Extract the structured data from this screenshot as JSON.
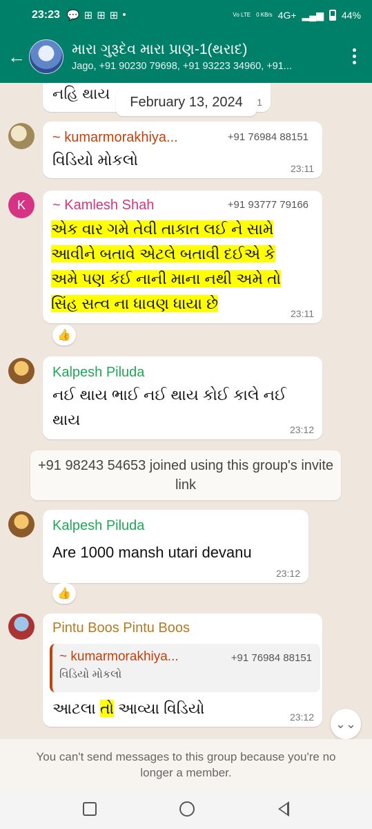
{
  "status_bar": {
    "time": "23:23",
    "net_lte": "Vo LTE",
    "speed": "0 KB/s",
    "network": "4G+",
    "battery": "44%"
  },
  "header": {
    "title": "મારા ગુરૂદેવ મારા પ્રાણ-1(થરાદ)",
    "subtitle": "Jago, +91 90230 79698, +91 93223 34960, +91..."
  },
  "chat": {
    "top_partial_text": "નહિ થાય",
    "top_partial_ts": "1",
    "date_chip": "February 13, 2024",
    "messages": [
      {
        "sender": "~ kumarmorakhiya...",
        "sender_color": "#c2410c",
        "phone": "+91 76984 88151",
        "text": "વિડિયો મોકલો",
        "time": "23:11"
      },
      {
        "sender": "~ Kamlesh Shah",
        "sender_color": "#d63384",
        "avatar_letter": "K",
        "phone": "+91 93777 79166",
        "lines": [
          "એક વાર ગમે તેવી તાકાત લઈ ને સામે",
          "આવીને બતાવે એટલે બતાવી દઈએ કે",
          "અમે પણ કંઈ નાની માના નથી અમે તો",
          "સિંહ સત્વ ના ધાવણ ધાયા છે"
        ],
        "time": "23:11",
        "reaction": "👍"
      },
      {
        "sender": "Kalpesh Piluda",
        "sender_color": "#1fa855",
        "lines": [
          "નઈ થાય ભાઈ નઈ થાય કોઈ કાલે નઈ",
          "થાય"
        ],
        "time": "23:12"
      },
      {
        "system_text": "+91 98243 54653 joined using this group's invite link"
      },
      {
        "sender": "Kalpesh Piluda",
        "sender_color": "#1fa855",
        "text": "Are 1000 mansh utari devanu",
        "time": "23:12",
        "reaction": "👍"
      },
      {
        "sender": "Pintu Boos Pintu Boos",
        "sender_color": "#b7791f",
        "quote_sender": "~ kumarmorakhiya...",
        "quote_phone": "+91 76984 88151",
        "quote_text": "વિડિયો મોકલો",
        "text_before": "આટલા ",
        "text_highlight": "તો",
        "text_after": " આવ્યા વિડિયો",
        "time": "23:12"
      }
    ]
  },
  "footer": {
    "notice": "You can't send messages to this group because you're no longer a member."
  }
}
